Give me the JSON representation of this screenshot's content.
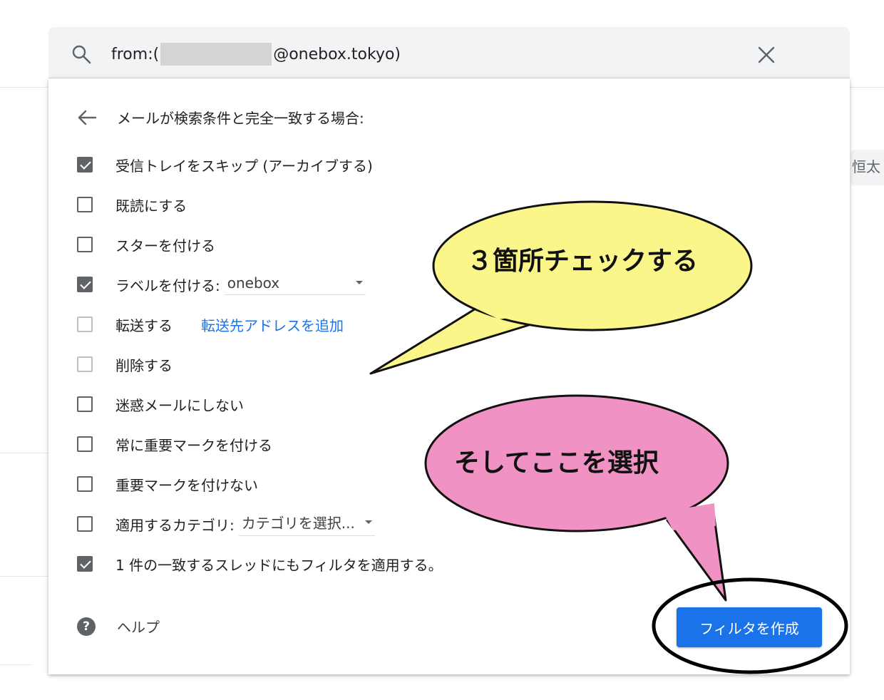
{
  "search": {
    "prefix": "from:(",
    "suffix": "@onebox.tokyo)"
  },
  "panel": {
    "back_label": "メールが検索条件と完全一致する場合:",
    "options": [
      {
        "label": "受信トレイをスキップ (アーカイブする)",
        "checked": true
      },
      {
        "label": "既読にする",
        "checked": false
      },
      {
        "label": "スターを付ける",
        "checked": false
      },
      {
        "label": "ラベルを付ける:",
        "checked": true,
        "select_value": "onebox"
      },
      {
        "label": "転送する",
        "checked": false,
        "link": "転送先アドレスを追加"
      },
      {
        "label": "削除する",
        "checked": false
      },
      {
        "label": "迷惑メールにしない",
        "checked": false
      },
      {
        "label": "常に重要マークを付ける",
        "checked": false
      },
      {
        "label": "重要マークを付けない",
        "checked": false
      },
      {
        "label": "適用するカテゴリ:",
        "checked": false,
        "select_value": "カテゴリを選択..."
      },
      {
        "label": "1 件の一致するスレッドにもフィルタを適用する。",
        "checked": true
      }
    ],
    "help_label": "ヘルプ",
    "create_button": "フィルタを作成"
  },
  "background": {
    "name_fragment": "恒太"
  },
  "annotations": {
    "bubble_yellow": "３箇所チェックする",
    "bubble_pink": "そしてここを選択",
    "yellow_color": "#fbf68a",
    "pink_color": "#f092c3"
  },
  "colors": {
    "accent": "#1a73e8",
    "checkbox": "#5f6368"
  }
}
